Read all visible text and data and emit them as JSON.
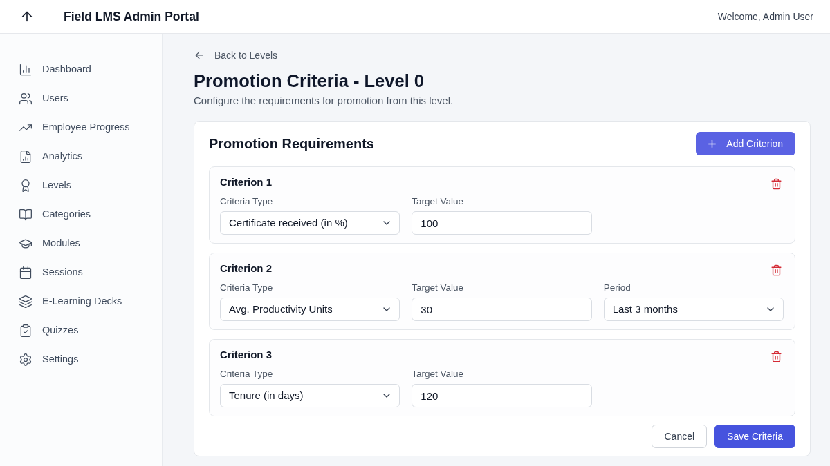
{
  "header": {
    "title": "Field LMS Admin Portal",
    "welcome": "Welcome, Admin User"
  },
  "sidebar": {
    "items": [
      {
        "label": "Dashboard",
        "selected": false
      },
      {
        "label": "Users",
        "selected": false
      },
      {
        "label": "Employee Progress",
        "selected": false
      },
      {
        "label": "Analytics",
        "selected": false
      },
      {
        "label": "Levels",
        "selected": false
      },
      {
        "label": "Categories",
        "selected": false
      },
      {
        "label": "Modules",
        "selected": false
      },
      {
        "label": "Sessions",
        "selected": false
      },
      {
        "label": "E-Learning Decks",
        "selected": false
      },
      {
        "label": "Quizzes",
        "selected": false
      },
      {
        "label": "Settings",
        "selected": false
      }
    ]
  },
  "back_link": "Back to Levels",
  "page": {
    "title": "Promotion Criteria - Level 0",
    "subtitle": "Configure the requirements for promotion from this level."
  },
  "requirements": {
    "title": "Promotion Requirements",
    "add_button": "Add Criterion",
    "criteria": [
      {
        "title": "Criterion 1",
        "fields": [
          {
            "kind": "select",
            "label": "Criteria Type",
            "value": "Certificate received (in %)"
          },
          {
            "kind": "input",
            "label": "Target Value",
            "value": "100"
          }
        ]
      },
      {
        "title": "Criterion 2",
        "fields": [
          {
            "kind": "select",
            "label": "Criteria Type",
            "value": "Avg. Productivity Units"
          },
          {
            "kind": "input",
            "label": "Target Value",
            "value": "30"
          },
          {
            "kind": "select",
            "label": "Period",
            "value": "Last 3 months"
          }
        ]
      },
      {
        "title": "Criterion 3",
        "fields": [
          {
            "kind": "select",
            "label": "Criteria Type",
            "value": "Tenure (in days)"
          },
          {
            "kind": "input",
            "label": "Target Value",
            "value": "120"
          }
        ]
      }
    ],
    "actions": [
      {
        "kind": "secondary",
        "label": "Cancel"
      },
      {
        "kind": "primary",
        "label": "Save Criteria"
      }
    ]
  }
}
